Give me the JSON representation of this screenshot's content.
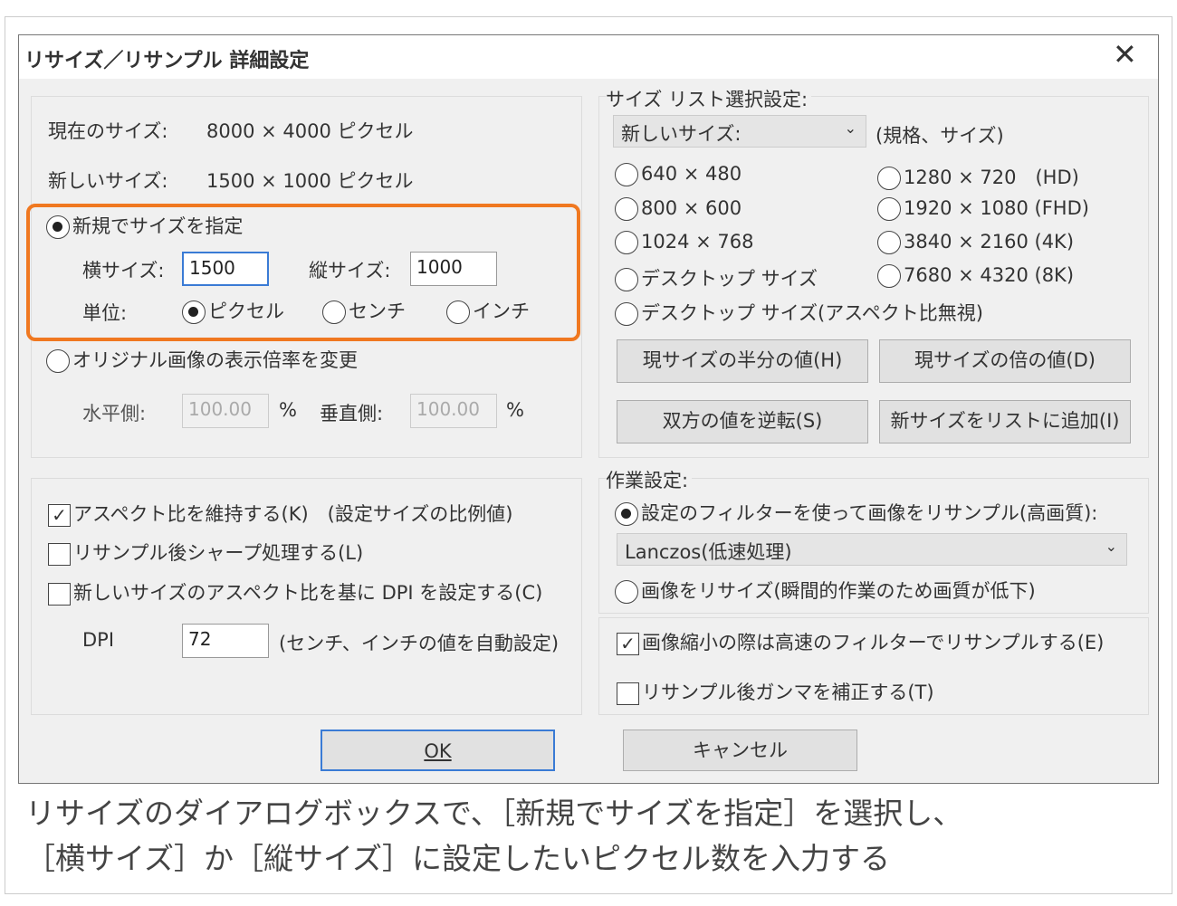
{
  "dialog": {
    "title": "リサイズ／リサンプル 詳細設定",
    "close_icon": "close-icon"
  },
  "left": {
    "current_label": "現在のサイズ:",
    "current_value": "8000 × 4000 ピクセル",
    "new_label": "新しいサイズ:",
    "new_value": "1500 × 1000 ピクセル",
    "specify_label": "新規でサイズを指定",
    "width_label": "横サイズ:",
    "width_value": "1500",
    "height_label": "縦サイズ:",
    "height_value": "1000",
    "unit_label": "単位:",
    "units": [
      "ピクセル",
      "センチ",
      "インチ"
    ],
    "scale_label": "オリジナル画像の表示倍率を変更",
    "h_label": "水平側:",
    "h_value": "100.00",
    "pct": "%",
    "v_label": "垂直側:",
    "v_value": "100.00",
    "keep_aspect": "アスペクト比を維持する(K)　(設定サイズの比例値)",
    "sharpen": "リサンプル後シャープ処理する(L)",
    "dpi_aspect": "新しいサイズのアスペクト比を基に DPI を設定する(C)",
    "dpi_label": "DPI",
    "dpi_value": "72",
    "dpi_note": "(センチ、インチの値を自動設定)"
  },
  "right": {
    "list_group": "サイズ リスト選択設定:",
    "list_select": "新しいサイズ:",
    "list_note": "(規格、サイズ)",
    "sizes_left": [
      "640 × 480",
      "800 × 600",
      "1024 × 768",
      "デスクトップ サイズ"
    ],
    "sizes_right": [
      "1280 × 720　(HD)",
      "1920 × 1080 (FHD)",
      "3840 × 2160 (4K)",
      "7680 × 4320 (8K)"
    ],
    "desktop_noaspect": "デスクトップ サイズ(アスペクト比無視)",
    "btn_half": "現サイズの半分の値(H)",
    "btn_double": "現サイズの倍の値(D)",
    "btn_swap": "双方の値を逆転(S)",
    "btn_add": "新サイズをリストに追加(I)",
    "work_group": "作業設定:",
    "filter_radio": "設定のフィルターを使って画像をリサンプル(高画質):",
    "filter_select": "Lanczos(低速処理)",
    "resize_radio": "画像をリサイズ(瞬間的作業のため画質が低下)",
    "fast_filter": "画像縮小の際は高速のフィルターでリサンプルする(E)",
    "gamma": "リサンプル後ガンマを補正する(T)"
  },
  "buttons": {
    "ok": "OK",
    "cancel": "キャンセル"
  },
  "caption": {
    "line1": "リサイズのダイアログボックスで、［新規でサイズを指定］を選択し、",
    "line2": "［横サイズ］か［縦サイズ］に設定したいピクセル数を入力する"
  },
  "colors": {
    "highlight": "#f07820"
  }
}
